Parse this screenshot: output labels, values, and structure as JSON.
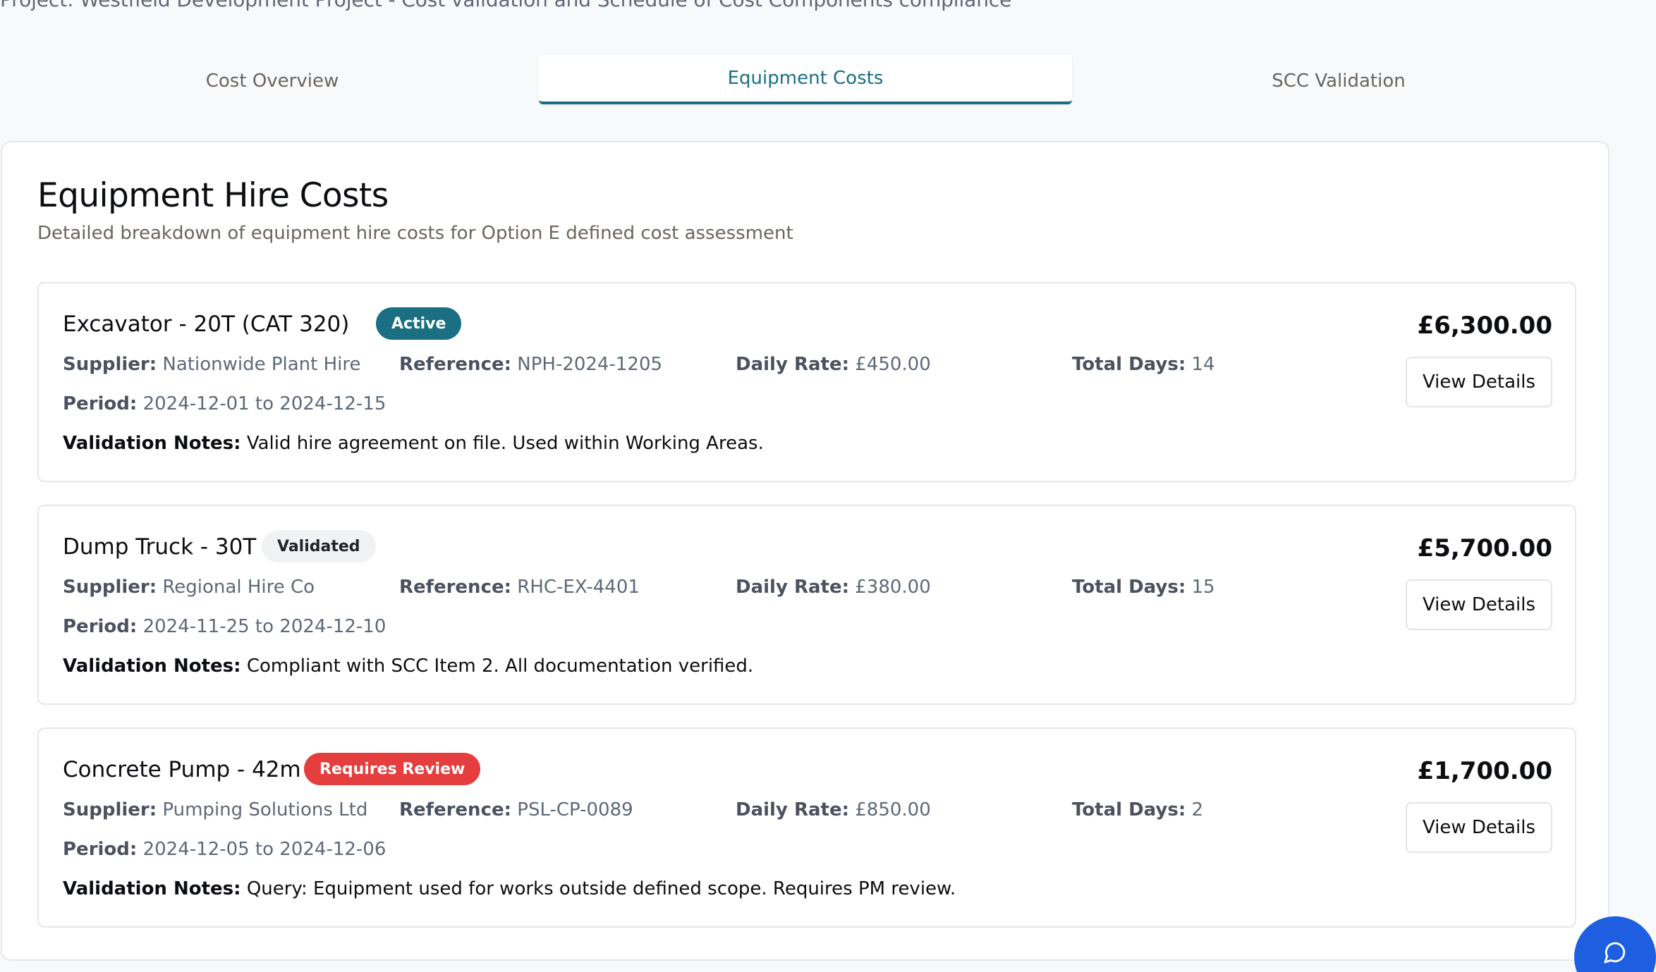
{
  "project_line": "Project: Westfield Development Project - Cost validation and Schedule of Cost Components compliance",
  "tabs": [
    {
      "label": "Cost Overview"
    },
    {
      "label": "Equipment Costs"
    },
    {
      "label": "SCC Validation"
    }
  ],
  "panel": {
    "title": "Equipment Hire Costs",
    "subtitle": "Detailed breakdown of equipment hire costs for Option E defined cost assessment"
  },
  "labels": {
    "supplier": "Supplier:",
    "reference": "Reference:",
    "daily_rate": "Daily Rate:",
    "total_days": "Total Days:",
    "period": "Period:",
    "validation_notes": "Validation Notes:",
    "view_details": "View Details"
  },
  "items": [
    {
      "name": "Excavator - 20T (CAT 320)",
      "status": "Active",
      "supplier": "Nationwide Plant Hire",
      "reference": "NPH-2024-1205",
      "daily_rate": "£450.00",
      "total_days": "14",
      "period": "2024-12-01 to 2024-12-15",
      "notes": "Valid hire agreement on file. Used within Working Areas.",
      "total": "£6,300.00"
    },
    {
      "name": "Dump Truck - 30T",
      "status": "Validated",
      "supplier": "Regional Hire Co",
      "reference": "RHC-EX-4401",
      "daily_rate": "£380.00",
      "total_days": "15",
      "period": "2024-11-25 to 2024-12-10",
      "notes": "Compliant with SCC Item 2. All documentation verified.",
      "total": "£5,700.00"
    },
    {
      "name": "Concrete Pump - 42m",
      "status": "Requires Review",
      "supplier": "Pumping Solutions Ltd",
      "reference": "PSL-CP-0089",
      "daily_rate": "£850.00",
      "total_days": "2",
      "period": "2024-12-05 to 2024-12-06",
      "notes": "Query: Equipment used for works outside defined scope. Requires PM review.",
      "total": "£1,700.00"
    }
  ],
  "icons": {
    "chat": "chat-bubble-icon"
  },
  "colors": {
    "accent": "#1a6f83",
    "active": "#1a6f83",
    "review": "#e53e3e",
    "fab": "#1d5fe0"
  }
}
